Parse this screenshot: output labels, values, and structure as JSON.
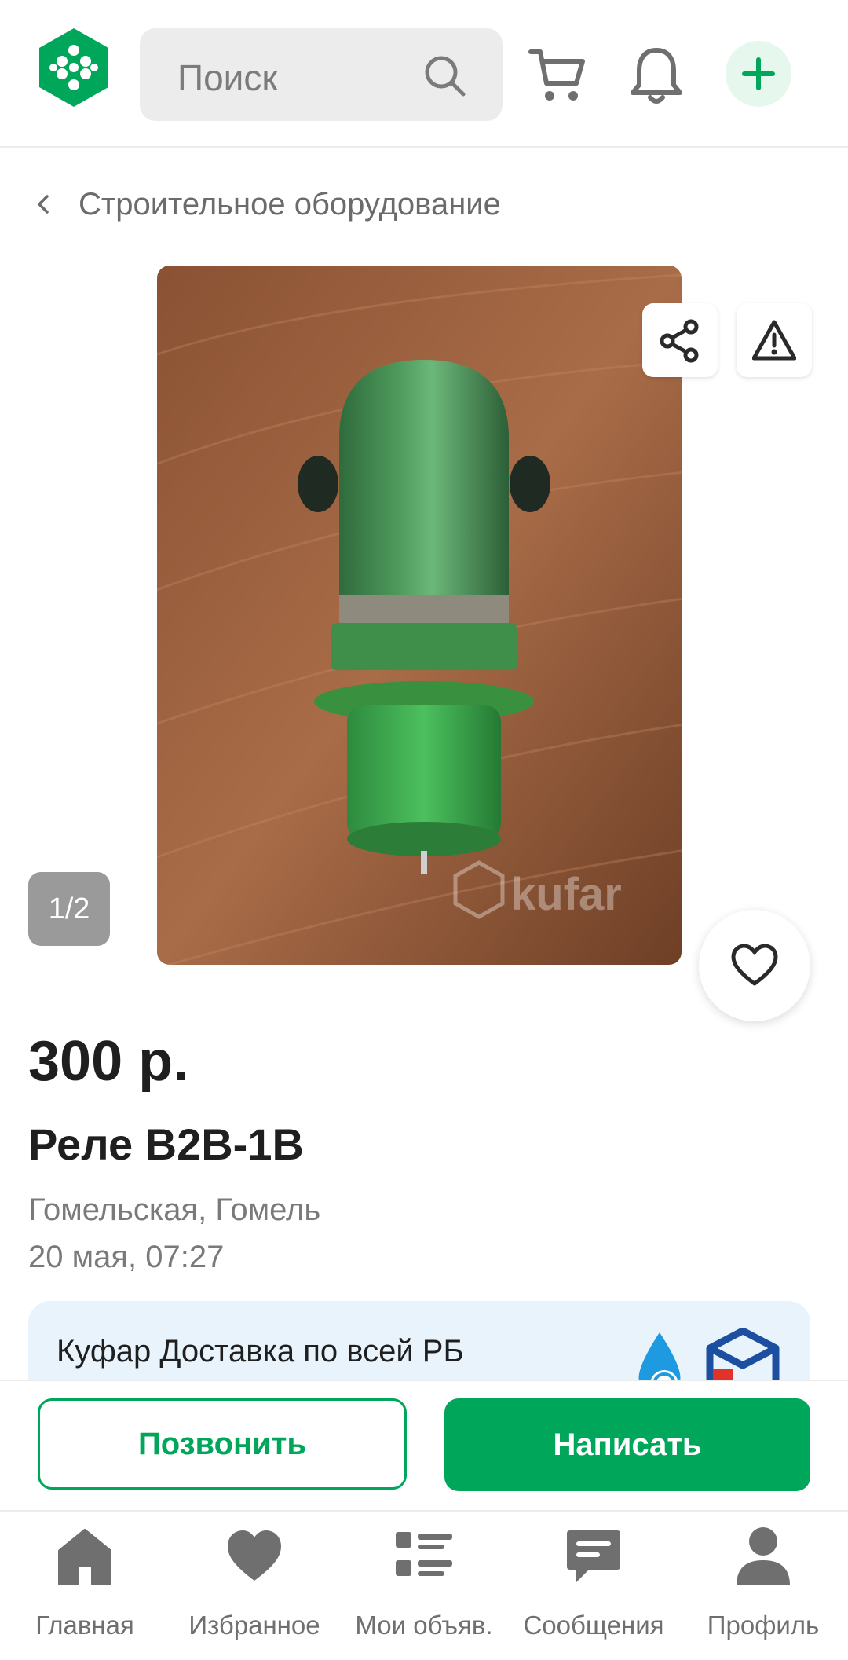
{
  "header": {
    "logo": "kufar-logo",
    "search_placeholder": "Поиск",
    "icons": [
      "search-icon",
      "cart-icon",
      "bell-icon",
      "plus-icon"
    ],
    "accent_color": "#00a65a"
  },
  "breadcrumb": {
    "label": "Строительное оборудование"
  },
  "gallery": {
    "counter": "1/2",
    "watermark": "kufar"
  },
  "listing": {
    "price": "300 р.",
    "title": "Реле В2В-1В",
    "location": "Гомельская, Гомель",
    "date": "20 мая, 07:27"
  },
  "delivery": {
    "text": "Куфар Доставка по всей РБ"
  },
  "actions": {
    "call_label": "Позвонить",
    "write_label": "Написать"
  },
  "nav": {
    "items": [
      {
        "label": "Главная",
        "icon": "home-icon"
      },
      {
        "label": "Избранное",
        "icon": "heart-icon"
      },
      {
        "label": "Мои объяв.",
        "icon": "list-icon"
      },
      {
        "label": "Сообщения",
        "icon": "chat-icon"
      },
      {
        "label": "Профиль",
        "icon": "person-icon"
      }
    ]
  }
}
